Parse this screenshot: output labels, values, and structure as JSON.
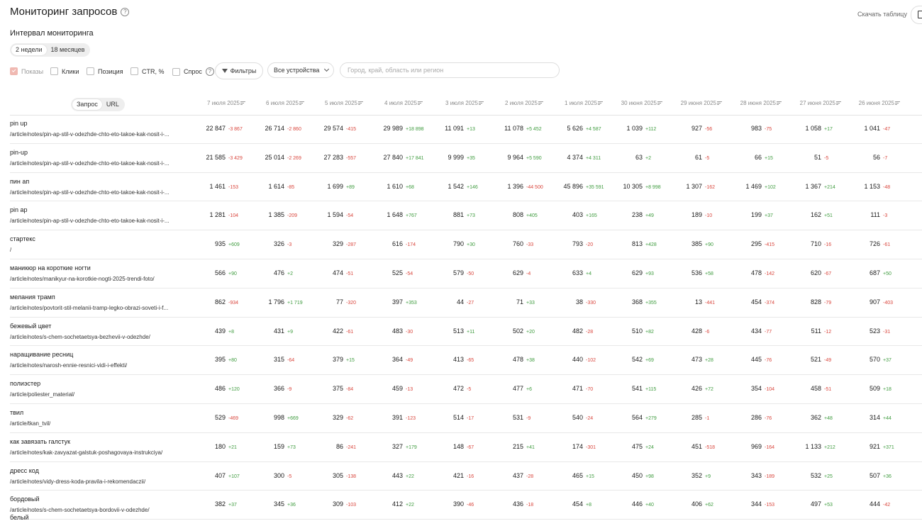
{
  "header": {
    "title": "Мониторинг запросов",
    "help_glyph": "?",
    "download_label": "Скачать таблицу"
  },
  "interval": {
    "label": "Интервал мониторинга",
    "options": [
      "2 недели",
      "18 месяцев"
    ],
    "selected": "2 недели"
  },
  "controls": {
    "checkboxes": [
      {
        "label": "Показы",
        "checked": true
      },
      {
        "label": "Клики",
        "checked": false
      },
      {
        "label": "Позиция",
        "checked": false
      },
      {
        "label": "CTR, %",
        "checked": false
      },
      {
        "label": "Спрос",
        "checked": false
      }
    ],
    "filters_label": "Фильтры",
    "devices_value": "Все устройства",
    "region_placeholder": "Город, край, область или регион"
  },
  "view_toggle": {
    "options": [
      "Запрос",
      "URL"
    ],
    "selected": "Запрос"
  },
  "dates": [
    "7 июля 2025",
    "6 июля 2025",
    "5 июля 2025",
    "4 июля 2025",
    "3 июля 2025",
    "2 июля 2025",
    "1 июля 2025",
    "30 июня 2025",
    "29 июня 2025",
    "28 июня 2025",
    "27 июня 2025",
    "26 июня 2025"
  ],
  "rows": [
    {
      "query": "pin up",
      "url": "/article/notes/pin-ap-stil-v-odezhde-chto-eto-takoe-kak-nosit-i-...",
      "cells": [
        [
          "22 847",
          "-3 867"
        ],
        [
          "26 714",
          "-2 860"
        ],
        [
          "29 574",
          "-415"
        ],
        [
          "29 989",
          "+18 898"
        ],
        [
          "11 091",
          "+13"
        ],
        [
          "11 078",
          "+5 452"
        ],
        [
          "5 626",
          "+4 587"
        ],
        [
          "1 039",
          "+112"
        ],
        [
          "927",
          "-56"
        ],
        [
          "983",
          "-75"
        ],
        [
          "1 058",
          "+17"
        ],
        [
          "1 041",
          "-47"
        ]
      ]
    },
    {
      "query": "pin-up",
      "url": "/article/notes/pin-ap-stil-v-odezhde-chto-eto-takoe-kak-nosit-i-...",
      "cells": [
        [
          "21 585",
          "-3 429"
        ],
        [
          "25 014",
          "-2 269"
        ],
        [
          "27 283",
          "-557"
        ],
        [
          "27 840",
          "+17 841"
        ],
        [
          "9 999",
          "+35"
        ],
        [
          "9 964",
          "+5 590"
        ],
        [
          "4 374",
          "+4 311"
        ],
        [
          "63",
          "+2"
        ],
        [
          "61",
          "-5"
        ],
        [
          "66",
          "+15"
        ],
        [
          "51",
          "-5"
        ],
        [
          "56",
          "-7"
        ]
      ]
    },
    {
      "query": "пин ап",
      "url": "/article/notes/pin-ap-stil-v-odezhde-chto-eto-takoe-kak-nosit-i-...",
      "cells": [
        [
          "1 461",
          "-153"
        ],
        [
          "1 614",
          "-85"
        ],
        [
          "1 699",
          "+89"
        ],
        [
          "1 610",
          "+68"
        ],
        [
          "1 542",
          "+146"
        ],
        [
          "1 396",
          "-44 500"
        ],
        [
          "45 896",
          "+35 591"
        ],
        [
          "10 305",
          "+8 998"
        ],
        [
          "1 307",
          "-162"
        ],
        [
          "1 469",
          "+102"
        ],
        [
          "1 367",
          "+214"
        ],
        [
          "1 153",
          "-48"
        ]
      ]
    },
    {
      "query": "pin ap",
      "url": "/article/notes/pin-ap-stil-v-odezhde-chto-eto-takoe-kak-nosit-i-...",
      "cells": [
        [
          "1 281",
          "-104"
        ],
        [
          "1 385",
          "-209"
        ],
        [
          "1 594",
          "-54"
        ],
        [
          "1 648",
          "+767"
        ],
        [
          "881",
          "+73"
        ],
        [
          "808",
          "+405"
        ],
        [
          "403",
          "+165"
        ],
        [
          "238",
          "+49"
        ],
        [
          "189",
          "-10"
        ],
        [
          "199",
          "+37"
        ],
        [
          "162",
          "+51"
        ],
        [
          "111",
          "-3"
        ]
      ]
    },
    {
      "query": "стартекс",
      "url": "/",
      "cells": [
        [
          "935",
          "+609"
        ],
        [
          "326",
          "-3"
        ],
        [
          "329",
          "-287"
        ],
        [
          "616",
          "-174"
        ],
        [
          "790",
          "+30"
        ],
        [
          "760",
          "-33"
        ],
        [
          "793",
          "-20"
        ],
        [
          "813",
          "+428"
        ],
        [
          "385",
          "+90"
        ],
        [
          "295",
          "-415"
        ],
        [
          "710",
          "-16"
        ],
        [
          "726",
          "-61"
        ]
      ]
    },
    {
      "query": "маникюр на короткие ногти",
      "url": "/article/notes/manikyur-na-korotkie-nogti-2025-trendi-foto/",
      "cells": [
        [
          "566",
          "+90"
        ],
        [
          "476",
          "+2"
        ],
        [
          "474",
          "-51"
        ],
        [
          "525",
          "-54"
        ],
        [
          "579",
          "-50"
        ],
        [
          "629",
          "-4"
        ],
        [
          "633",
          "+4"
        ],
        [
          "629",
          "+93"
        ],
        [
          "536",
          "+58"
        ],
        [
          "478",
          "-142"
        ],
        [
          "620",
          "-67"
        ],
        [
          "687",
          "+50"
        ]
      ]
    },
    {
      "query": "мелания трамп",
      "url": "/article/notes/povtorit-stil-melanii-tramp-legko-obrazi-soveti-i-f...",
      "cells": [
        [
          "862",
          "-934"
        ],
        [
          "1 796",
          "+1 719"
        ],
        [
          "77",
          "-320"
        ],
        [
          "397",
          "+353"
        ],
        [
          "44",
          "-27"
        ],
        [
          "71",
          "+33"
        ],
        [
          "38",
          "-330"
        ],
        [
          "368",
          "+355"
        ],
        [
          "13",
          "-441"
        ],
        [
          "454",
          "-374"
        ],
        [
          "828",
          "-79"
        ],
        [
          "907",
          "-403"
        ]
      ]
    },
    {
      "query": "бежевый цвет",
      "url": "/article/notes/s-chem-sochetaetsya-bezhevii-v-odezhde/",
      "cells": [
        [
          "439",
          "+8"
        ],
        [
          "431",
          "+9"
        ],
        [
          "422",
          "-61"
        ],
        [
          "483",
          "-30"
        ],
        [
          "513",
          "+11"
        ],
        [
          "502",
          "+20"
        ],
        [
          "482",
          "-28"
        ],
        [
          "510",
          "+82"
        ],
        [
          "428",
          "-6"
        ],
        [
          "434",
          "-77"
        ],
        [
          "511",
          "-12"
        ],
        [
          "523",
          "-31"
        ]
      ]
    },
    {
      "query": "наращивание ресниц",
      "url": "/article/notes/narosh-ennie-resnici-vidi-i-effekti/",
      "cells": [
        [
          "395",
          "+80"
        ],
        [
          "315",
          "-64"
        ],
        [
          "379",
          "+15"
        ],
        [
          "364",
          "-49"
        ],
        [
          "413",
          "-65"
        ],
        [
          "478",
          "+38"
        ],
        [
          "440",
          "-102"
        ],
        [
          "542",
          "+69"
        ],
        [
          "473",
          "+28"
        ],
        [
          "445",
          "-76"
        ],
        [
          "521",
          "-49"
        ],
        [
          "570",
          "+37"
        ]
      ]
    },
    {
      "query": "полиэстер",
      "url": "/article/poliester_material/",
      "cells": [
        [
          "486",
          "+120"
        ],
        [
          "366",
          "-9"
        ],
        [
          "375",
          "-84"
        ],
        [
          "459",
          "-13"
        ],
        [
          "472",
          "-5"
        ],
        [
          "477",
          "+6"
        ],
        [
          "471",
          "-70"
        ],
        [
          "541",
          "+115"
        ],
        [
          "426",
          "+72"
        ],
        [
          "354",
          "-104"
        ],
        [
          "458",
          "-51"
        ],
        [
          "509",
          "+18"
        ]
      ]
    },
    {
      "query": "твил",
      "url": "/article/tkan_tvil/",
      "cells": [
        [
          "529",
          "-469"
        ],
        [
          "998",
          "+669"
        ],
        [
          "329",
          "-62"
        ],
        [
          "391",
          "-123"
        ],
        [
          "514",
          "-17"
        ],
        [
          "531",
          "-9"
        ],
        [
          "540",
          "-24"
        ],
        [
          "564",
          "+279"
        ],
        [
          "285",
          "-1"
        ],
        [
          "286",
          "-76"
        ],
        [
          "362",
          "+48"
        ],
        [
          "314",
          "+44"
        ]
      ]
    },
    {
      "query": "как завязать галстук",
      "url": "/article/notes/kak-zavyazat-galstuk-poshagovaya-instrukciya/",
      "cells": [
        [
          "180",
          "+21"
        ],
        [
          "159",
          "+73"
        ],
        [
          "86",
          "-241"
        ],
        [
          "327",
          "+179"
        ],
        [
          "148",
          "-67"
        ],
        [
          "215",
          "+41"
        ],
        [
          "174",
          "-301"
        ],
        [
          "475",
          "+24"
        ],
        [
          "451",
          "-518"
        ],
        [
          "969",
          "-164"
        ],
        [
          "1 133",
          "+212"
        ],
        [
          "921",
          "+371"
        ]
      ]
    },
    {
      "query": "дресс код",
      "url": "/article/notes/vidy-dress-koda-pravila-i-rekomendaczii/",
      "cells": [
        [
          "407",
          "+107"
        ],
        [
          "300",
          "-5"
        ],
        [
          "305",
          "-138"
        ],
        [
          "443",
          "+22"
        ],
        [
          "421",
          "-16"
        ],
        [
          "437",
          "-28"
        ],
        [
          "465",
          "+15"
        ],
        [
          "450",
          "+98"
        ],
        [
          "352",
          "+9"
        ],
        [
          "343",
          "-189"
        ],
        [
          "532",
          "+25"
        ],
        [
          "507",
          "+36"
        ]
      ]
    },
    {
      "query": "бордовый",
      "url": "/article/notes/s-chem-sochetaetsya-bordovii-v-odezhde/",
      "cells": [
        [
          "382",
          "+37"
        ],
        [
          "345",
          "+36"
        ],
        [
          "309",
          "-103"
        ],
        [
          "412",
          "+22"
        ],
        [
          "390",
          "-46"
        ],
        [
          "436",
          "-18"
        ],
        [
          "454",
          "+8"
        ],
        [
          "446",
          "+40"
        ],
        [
          "406",
          "+62"
        ],
        [
          "344",
          "-153"
        ],
        [
          "497",
          "+53"
        ],
        [
          "444",
          "-42"
        ]
      ]
    }
  ],
  "last_row_query": "белый",
  "colors": {
    "positive": "#3e9b3e",
    "negative": "#d9453c",
    "checked": "#f0b9b2"
  }
}
